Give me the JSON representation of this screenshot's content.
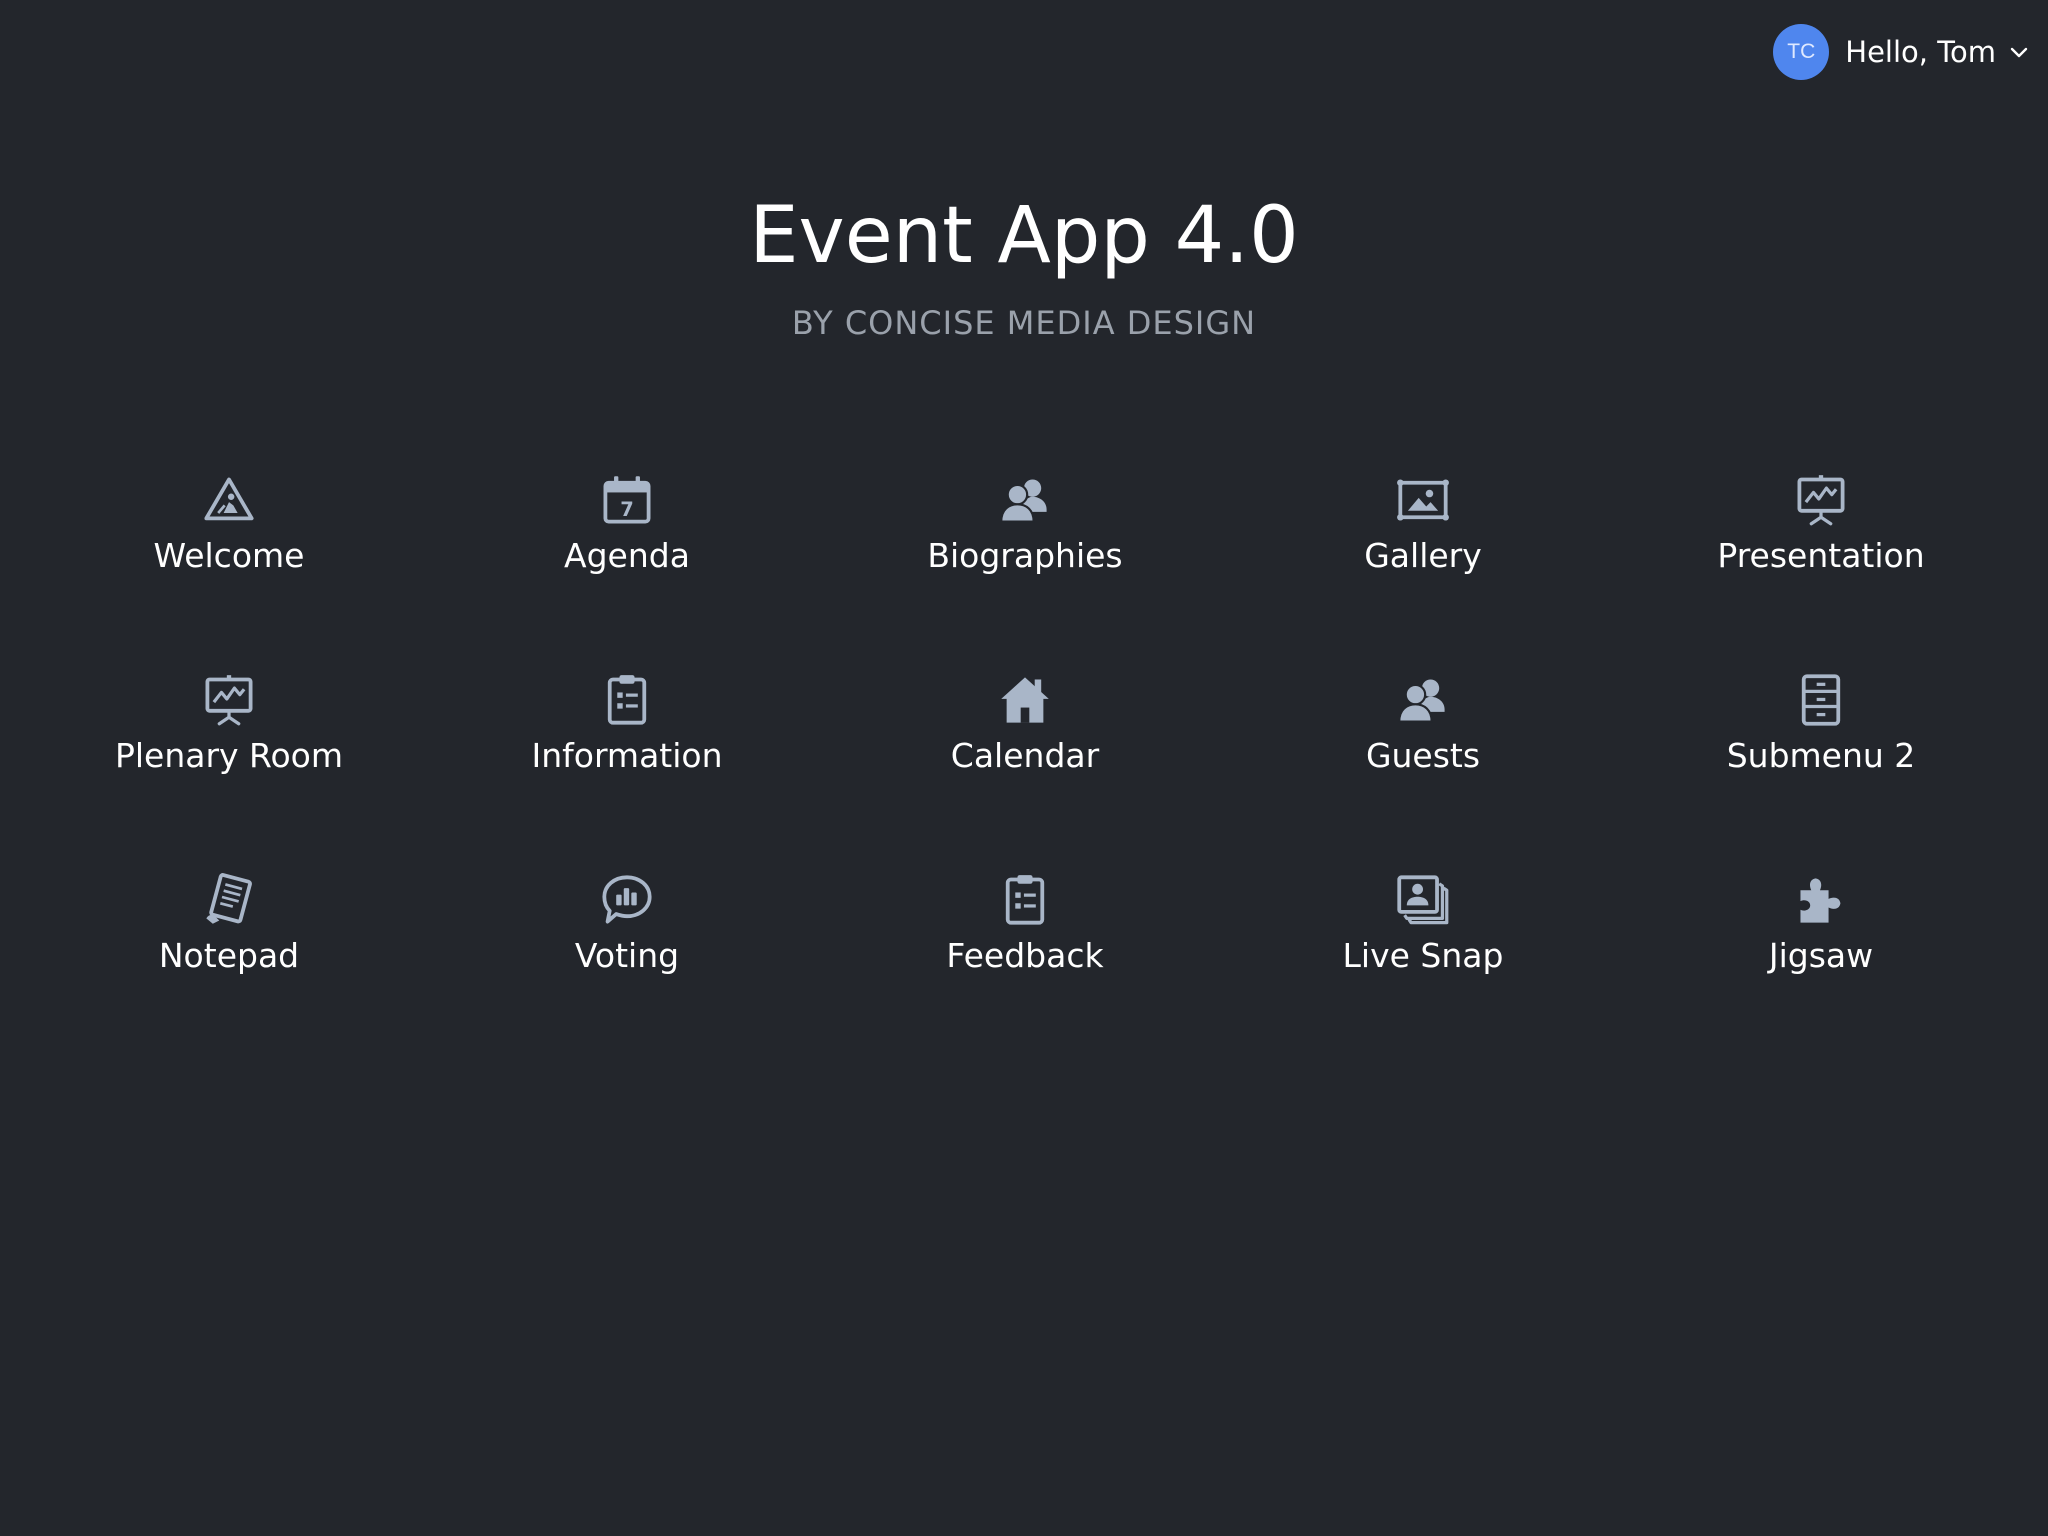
{
  "header": {
    "title": "Event App 4.0",
    "subtitle": "BY CONCISE MEDIA DESIGN"
  },
  "user": {
    "initials": "TC",
    "greeting": "Hello, Tom",
    "avatar_color": "#4f86ee"
  },
  "colors": {
    "background": "#23262c",
    "icon": "#a9b6c8",
    "text": "#ffffff",
    "subtitle": "#9aa1ab"
  },
  "tiles": [
    {
      "label": "Welcome",
      "icon": "construction-warning-icon"
    },
    {
      "label": "Agenda",
      "icon": "calendar-icon"
    },
    {
      "label": "Biographies",
      "icon": "users-icon"
    },
    {
      "label": "Gallery",
      "icon": "picture-frame-icon"
    },
    {
      "label": "Presentation",
      "icon": "presentation-board-icon"
    },
    {
      "label": "Plenary Room",
      "icon": "presentation-board-icon"
    },
    {
      "label": "Information",
      "icon": "clipboard-list-icon"
    },
    {
      "label": "Calendar",
      "icon": "home-icon"
    },
    {
      "label": "Guests",
      "icon": "users-icon"
    },
    {
      "label": "Submenu 2",
      "icon": "file-cabinet-icon"
    },
    {
      "label": "Notepad",
      "icon": "notepad-icon"
    },
    {
      "label": "Voting",
      "icon": "chat-poll-icon"
    },
    {
      "label": "Feedback",
      "icon": "clipboard-list-icon"
    },
    {
      "label": "Live Snap",
      "icon": "photo-stack-icon"
    },
    {
      "label": "Jigsaw",
      "icon": "puzzle-icon"
    }
  ]
}
